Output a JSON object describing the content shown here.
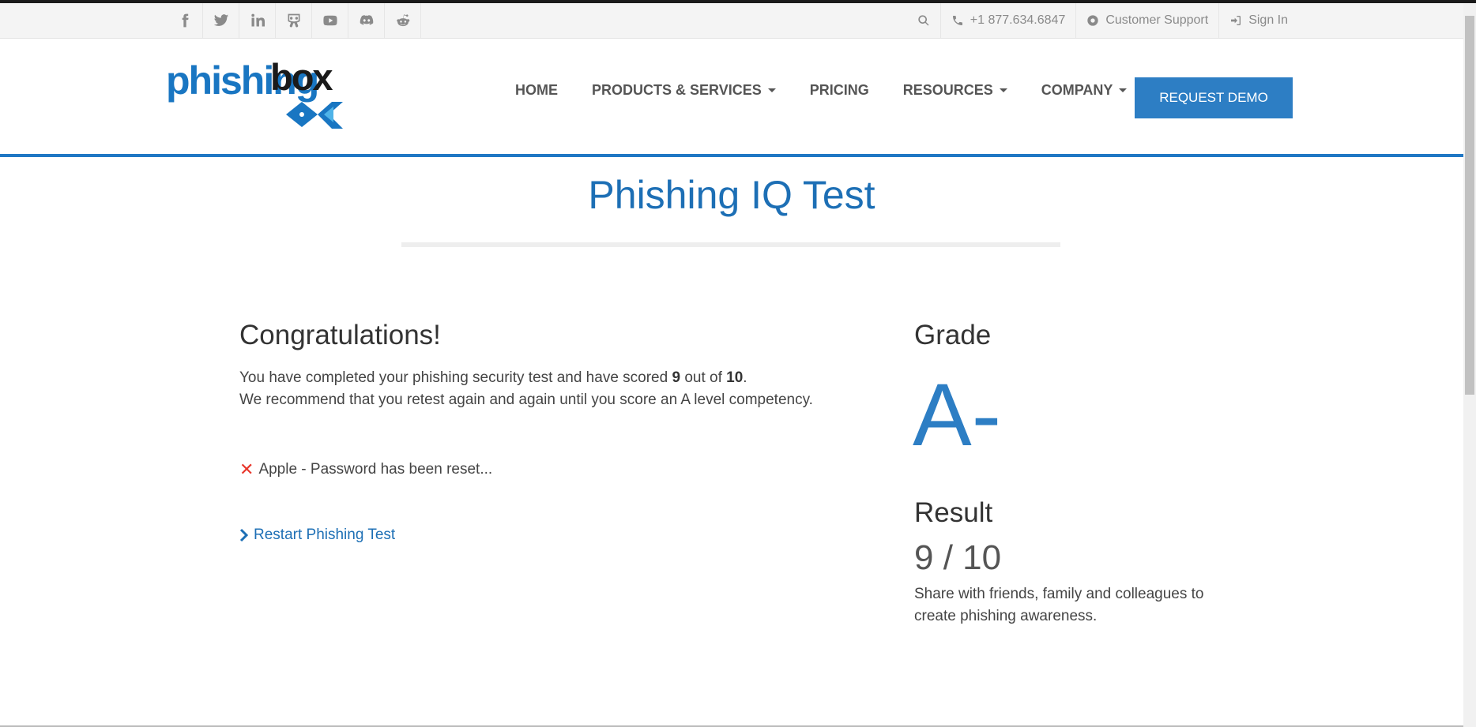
{
  "topbar": {
    "social": [
      "facebook-icon",
      "twitter-icon",
      "linkedin-icon",
      "slideshare-icon",
      "youtube-icon",
      "discord-icon",
      "reddit-icon"
    ],
    "phone": "+1 877.634.6847",
    "support": "Customer Support",
    "signin": "Sign In"
  },
  "logo": {
    "part1": "phishing",
    "part2": "box"
  },
  "nav": {
    "home": "HOME",
    "products": "PRODUCTS & SERVICES",
    "pricing": "PRICING",
    "resources": "RESOURCES",
    "company": "COMPANY",
    "demo": "REQUEST DEMO"
  },
  "page": {
    "title": "Phishing IQ Test",
    "congrats": "Congratulations!",
    "line1_pre": "You have completed your phishing security test and have scored ",
    "score_value": "9",
    "line1_mid": " out of ",
    "score_total": "10",
    "line1_post": ".",
    "line2": "We recommend that you retest again and again until you score an A level competency.",
    "wrong_item": "Apple - Password has been reset...",
    "restart": "Restart Phishing Test"
  },
  "sidebar": {
    "grade_heading": "Grade",
    "grade": "A-",
    "result_heading": "Result",
    "result": "9 / 10",
    "share": "Share with friends, family and colleagues to create phishing awareness."
  },
  "colors": {
    "brand_blue": "#1d6fb5",
    "accent_line": "#2077c4",
    "button": "#2d7ec4",
    "wrong": "#e8362b"
  }
}
